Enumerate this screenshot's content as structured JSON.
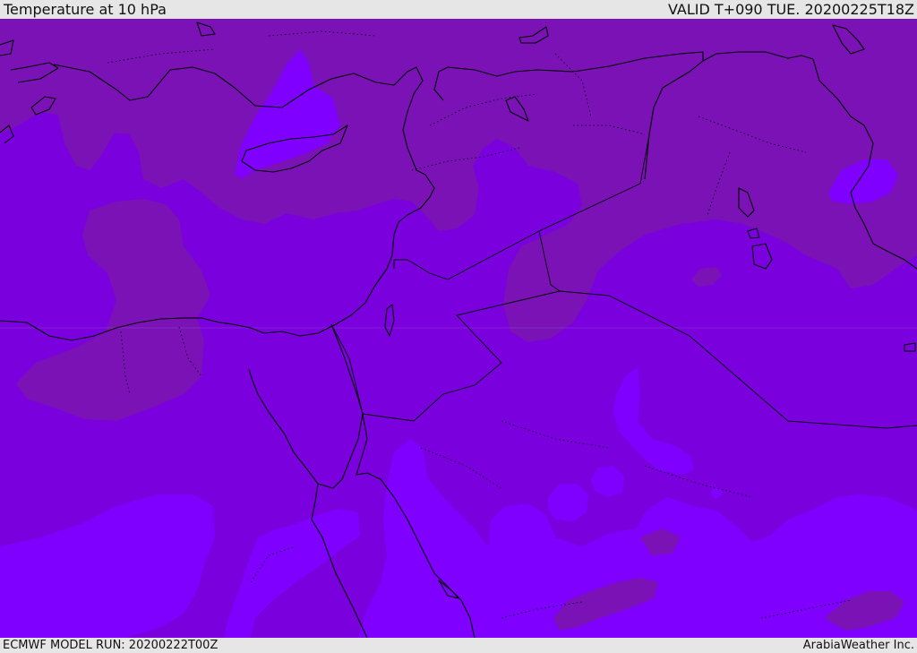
{
  "header": {
    "title": "Temperature at 10 hPa",
    "valid_time": "VALID T+090 TUE. 20200225T18Z"
  },
  "footer": {
    "model_run": "ECMWF MODEL RUN: 20200222T00Z",
    "credit": "ArabiaWeather Inc."
  },
  "colors": {
    "band_dark": "#7a12b6",
    "band_mid": "#7a00de",
    "band_light": "#7f00ff",
    "coastline": "#000000",
    "border": "#000000"
  }
}
